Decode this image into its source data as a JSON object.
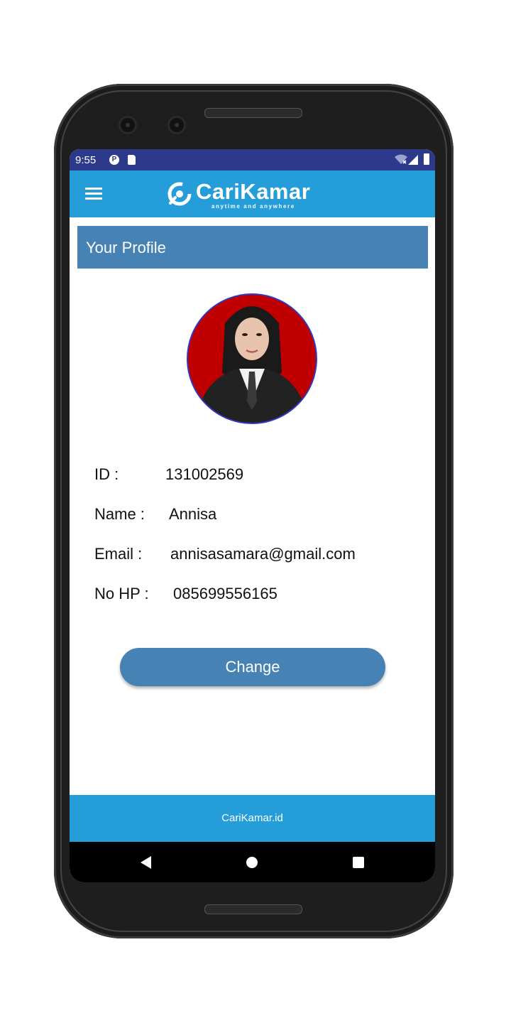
{
  "status_bar": {
    "time": "9:55"
  },
  "app_bar": {
    "logo_text": "CariKamar",
    "logo_tagline": "anytime and anywhere",
    "brand_color": "#259dd9"
  },
  "profile_section": {
    "title": "Your Profile",
    "header_color": "#4682b4"
  },
  "profile": {
    "fields": [
      {
        "label": "ID :",
        "value": "131002569"
      },
      {
        "label": "Name :",
        "value": "Annisa"
      },
      {
        "label": "Email :",
        "value": "annisasamara@gmail.com"
      },
      {
        "label": "No HP :",
        "value": "085699556165"
      }
    ]
  },
  "actions": {
    "change_label": "Change"
  },
  "footer": {
    "text": "CariKamar.id"
  },
  "icons": [
    "menu-icon",
    "wifi-icon",
    "signal-icon",
    "battery-icon",
    "back-icon",
    "home-icon",
    "recents-icon"
  ]
}
